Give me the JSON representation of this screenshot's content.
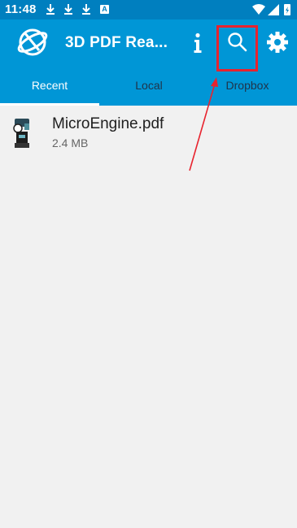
{
  "statusbar": {
    "time": "11:48",
    "notification_icons": [
      "download-icon",
      "download-icon",
      "download-icon",
      "a-icon"
    ],
    "a_letter": "A",
    "right_icons": [
      "wifi-icon",
      "signal-icon",
      "battery-icon"
    ]
  },
  "appbar": {
    "title": "3D PDF Rea...",
    "actions": [
      "info-icon",
      "search-icon",
      "gear-icon"
    ]
  },
  "tabs": [
    {
      "label": "Recent",
      "active": true
    },
    {
      "label": "Local",
      "active": false
    },
    {
      "label": "Dropbox",
      "active": false
    }
  ],
  "files": [
    {
      "name": "MicroEngine.pdf",
      "size": "2.4 MB"
    }
  ],
  "colors": {
    "status_bar": "#007fbf",
    "app_bar": "#0096d6",
    "background": "#f1f1f1",
    "annotation": "#e8232e",
    "inactive_tab": "#20344a"
  }
}
